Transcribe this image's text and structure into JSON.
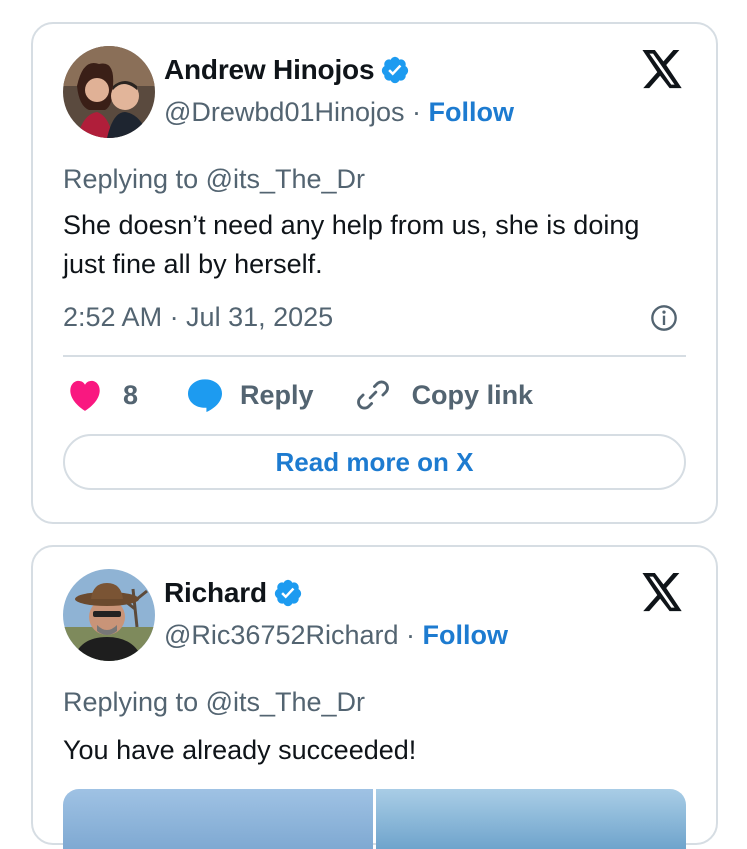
{
  "tweets": [
    {
      "author_name": "Andrew Hinojos",
      "handle": "@Drewbd01Hinojos",
      "separator": "·",
      "follow_label": "Follow",
      "replying_to": "Replying to @its_The_Dr",
      "text": "She doesn’t need any help from us, she is doing just fine all by herself.",
      "timestamp": "2:52 AM · Jul 31, 2025",
      "like_count": "8",
      "reply_label": "Reply",
      "copy_link_label": "Copy link",
      "read_more_label": "Read more on X"
    },
    {
      "author_name": "Richard",
      "handle": "@Ric36752Richard",
      "separator": "·",
      "follow_label": "Follow",
      "replying_to": "Replying to @its_The_Dr",
      "text": "You have already succeeded!"
    }
  ],
  "icons": {
    "verified": "verified-badge-icon",
    "x_logo": "x-logo-icon",
    "info": "info-icon",
    "like": "heart-icon",
    "reply": "speech-bubble-icon",
    "copy_link": "link-icon"
  },
  "colors": {
    "accent": "#1d7bd0",
    "verified": "#1d9bf0",
    "heart": "#f91880",
    "muted_text": "#536471",
    "border": "#d6dde3"
  }
}
